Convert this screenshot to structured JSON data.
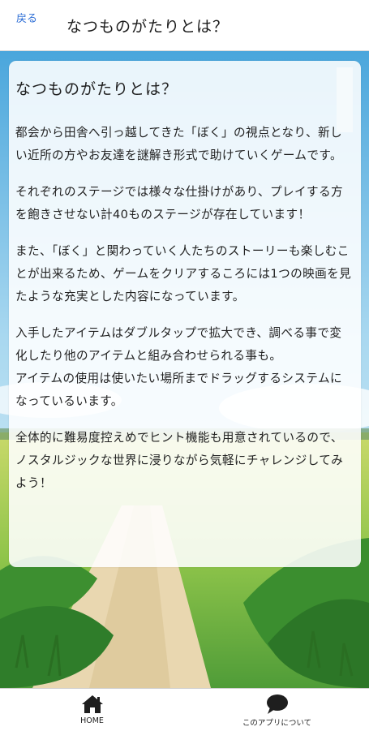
{
  "header": {
    "back_label": "戻る",
    "title": "なつものがたりとは？"
  },
  "card": {
    "title": "なつものがたりとは？",
    "paragraphs": [
      "都会から田舎へ引っ越してきた「ぼく」の視点となり、新しい近所の方やお友達を謎解き形式で助けていくゲームです。",
      "それぞれのステージでは様々な仕掛けがあり、プレイする方を飽きさせない計40ものステージが存在しています！",
      "また、「ぼく」と関わっていく人たちのストーリーも楽しむことが出来るため、ゲームをクリアするころには1つの映画を見たような充実とした内容になっています。",
      "入手したアイテムはダブルタップで拡大でき、調べる事で変化したり他のアイテムと組み合わせられる事も。",
      "アイテムの使用は使いたい場所までドラッグするシステムになっているいます。",
      "全体的に難易度控えめでヒント機能も用意されているので、ノスタルジックな世界に浸りながら気軽にチャレンジしてみよう！"
    ]
  },
  "tabbar": {
    "home": {
      "label": "HOME",
      "icon": "home-icon"
    },
    "about": {
      "label": "このアプリについて",
      "icon": "speech-bubble-icon"
    }
  },
  "colors": {
    "back_link": "#2f6fd6",
    "sky": "#7ec4e8",
    "grass": "#3f9e3a",
    "path": "#e7d6b2"
  }
}
